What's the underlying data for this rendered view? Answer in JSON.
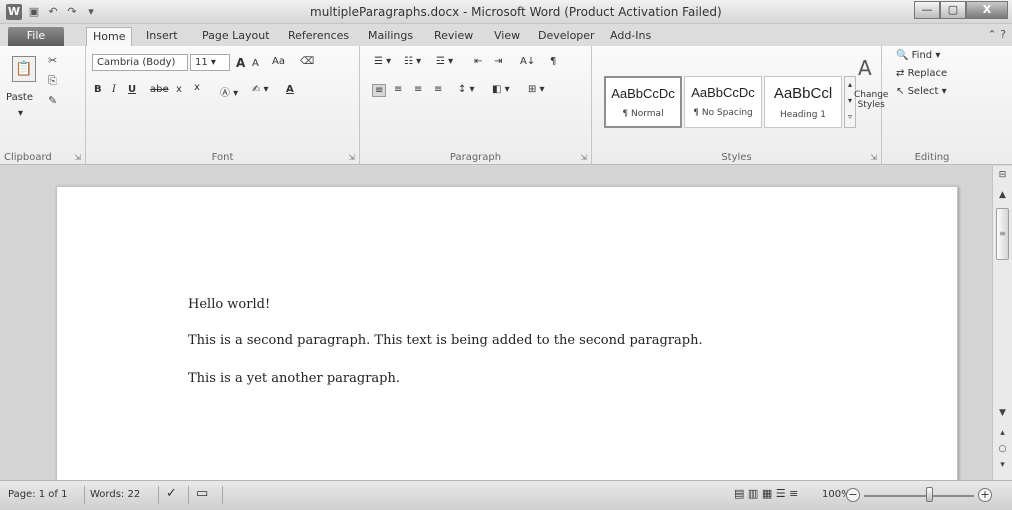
{
  "window": {
    "title": "multipleParagraphs.docx - Microsoft Word (Product Activation Failed)",
    "app_icon": "W",
    "min_glyph": "—",
    "max_glyph": "▢",
    "close_glyph": "X"
  },
  "qat": {
    "save_icon": "save-icon",
    "undo_icon": "undo-icon",
    "redo_icon": "redo-icon",
    "customize_icon": "dropdown-icon"
  },
  "tabs": [
    "File",
    "Home",
    "Insert",
    "Page Layout",
    "References",
    "Mailings",
    "Review",
    "View",
    "Developer",
    "Add-Ins"
  ],
  "ribbon": {
    "clipboard": {
      "label": "Clipboard",
      "paste": "Paste"
    },
    "font": {
      "label": "Font",
      "family": "Cambria (Body)",
      "size": "11",
      "grow": "A",
      "shrink": "A",
      "case": "Aa",
      "bold": "B",
      "italic": "I",
      "underline": "U",
      "strike": "abe",
      "sub": "x",
      "sup": "x",
      "color": "A"
    },
    "paragraph": {
      "label": "Paragraph",
      "pilcrow": "¶",
      "sort": "A↓"
    },
    "styles": {
      "label": "Styles",
      "cards": [
        {
          "sample": "AaBbCcDc",
          "name": "¶ Normal"
        },
        {
          "sample": "AaBbCcDc",
          "name": "¶ No Spacing"
        },
        {
          "sample": "AaBbCcl",
          "name": "Heading 1"
        }
      ],
      "change_styles": [
        "Change",
        "Styles"
      ]
    },
    "editing": {
      "label": "Editing",
      "find": "Find",
      "replace": "Replace",
      "select": "Select"
    }
  },
  "document": {
    "paragraphs": [
      "Hello world!",
      "This is a second paragraph. This text is being added to the second paragraph.",
      "This is a yet another paragraph."
    ]
  },
  "status": {
    "page": "Page: 1 of 1",
    "words": "Words: 22",
    "zoom": "100%",
    "zoom_level": 1.0
  },
  "colors": {
    "ribbon_bg": "#f2f2f2",
    "file_tab": "#6e6e6e",
    "doc_bg": "#d4d4d4"
  }
}
